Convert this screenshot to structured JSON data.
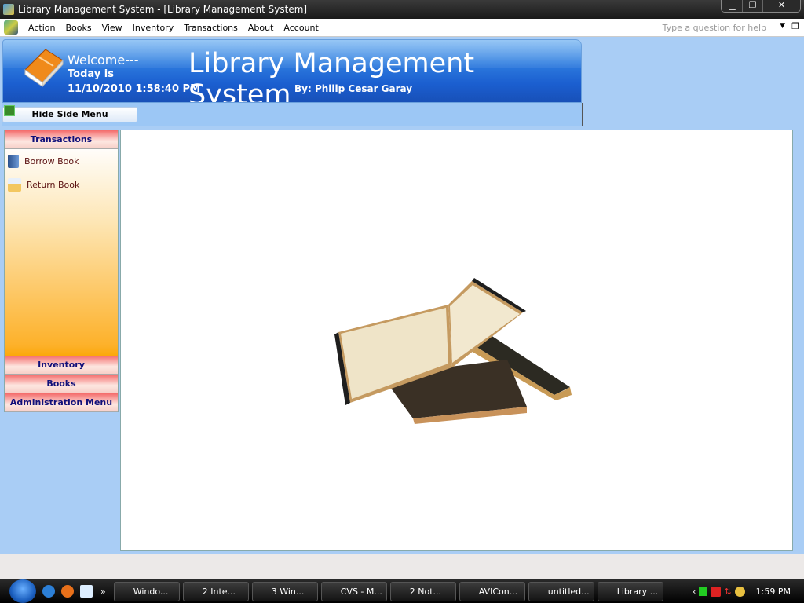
{
  "window": {
    "title": "Library Management System - [Library Management System]",
    "buttons": [
      "minimize",
      "restore",
      "close"
    ]
  },
  "menu": {
    "items": [
      "Action",
      "Books",
      "View",
      "Inventory",
      "Transactions",
      "About",
      "Account"
    ],
    "help_placeholder": "Type a question for help"
  },
  "banner": {
    "welcome": "Welcome---",
    "today_label": "Today is",
    "datetime": "11/10/2010 1:58:40 PM",
    "title": "Library Management System",
    "author": "By: Philip Cesar Garay"
  },
  "toolbar": {
    "hide_side_menu": "Hide Side Menu"
  },
  "sidebar": {
    "sections": [
      {
        "label": "Transactions",
        "items": [
          {
            "label": "Borrow Book",
            "icon": "book-icon"
          },
          {
            "label": "Return Book",
            "icon": "folder-icon"
          }
        ]
      },
      {
        "label": "Inventory"
      },
      {
        "label": "Books"
      },
      {
        "label": "Administration Menu"
      }
    ]
  },
  "taskbar": {
    "items": [
      "Windo...",
      "2 Inte...",
      "3 Win...",
      "CVS - M...",
      "2 Not...",
      "AVICon...",
      "untitled...",
      "Library ..."
    ],
    "clock": "1:59 PM"
  }
}
